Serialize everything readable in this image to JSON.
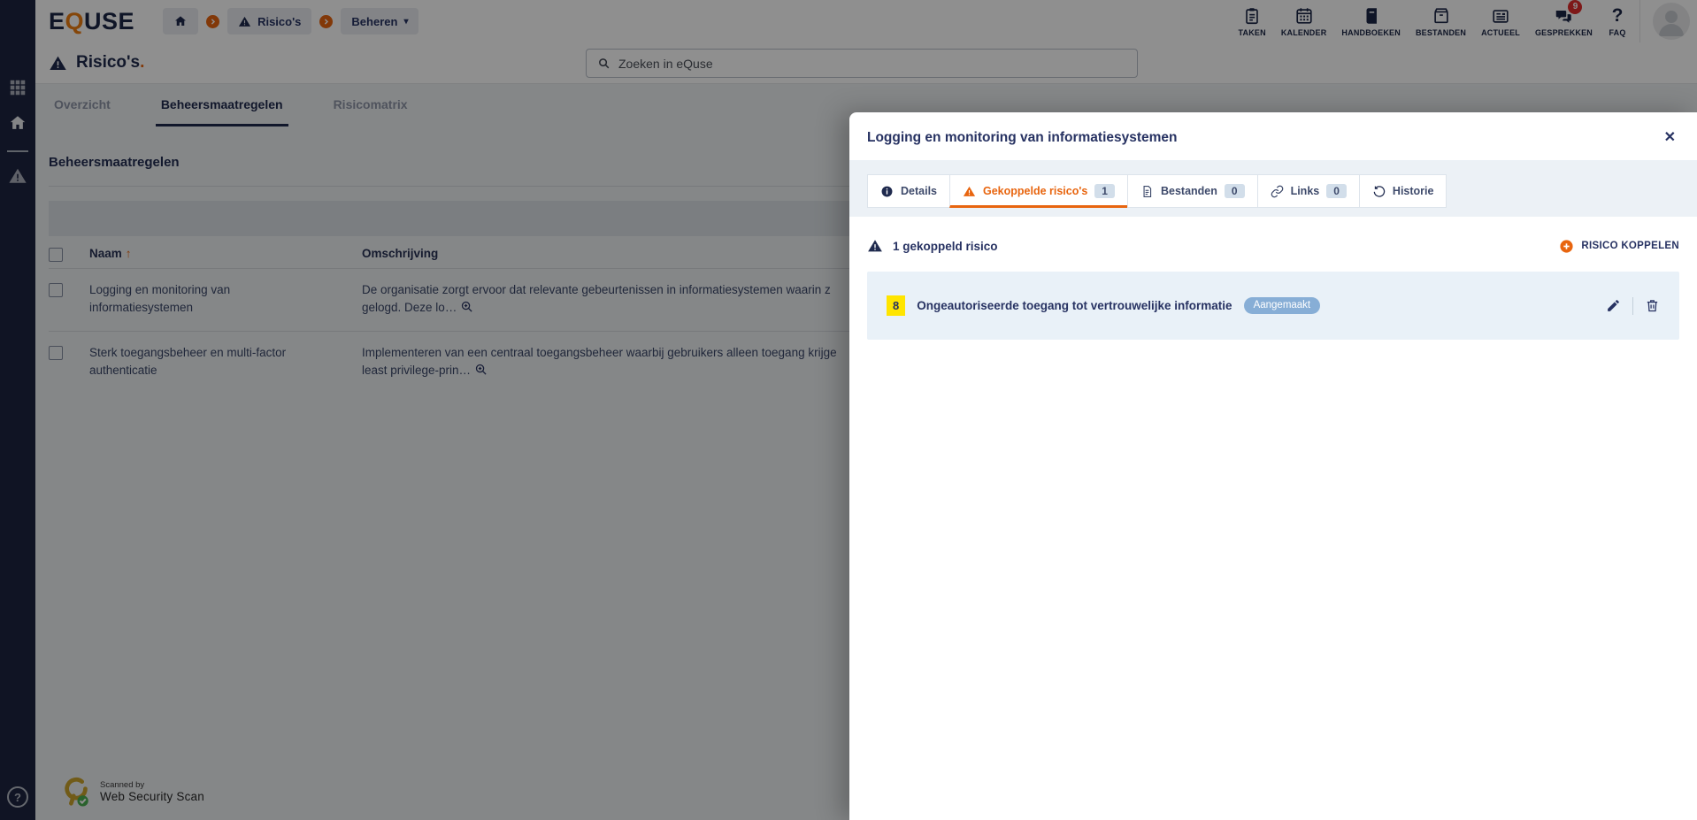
{
  "colors": {
    "accent_orange": "#e8650f",
    "brand_navy": "#1f2a4e",
    "status_blue": "#87aed6",
    "risk_yellow": "#ffe500",
    "badge_red": "#e02b2b"
  },
  "brand": {
    "logo_e": "E",
    "logo_q": "Q",
    "logo_use": "USE"
  },
  "header": {
    "breadcrumb": {
      "risicos_label": "Risico's",
      "beheren_label": "Beheren"
    },
    "nav": [
      {
        "label": "TAKEN",
        "icon": "clipboard-icon"
      },
      {
        "label": "KALENDER",
        "icon": "calendar-icon"
      },
      {
        "label": "HANDBOEKEN",
        "icon": "book-icon"
      },
      {
        "label": "BESTANDEN",
        "icon": "archive-box-icon"
      },
      {
        "label": "ACTUEEL",
        "icon": "newspaper-icon"
      },
      {
        "label": "GESPREKKEN",
        "icon": "chat-icon",
        "badge": "9"
      },
      {
        "label": "FAQ",
        "icon": "question-icon"
      }
    ]
  },
  "page": {
    "title": "Risico's",
    "title_suffix": ".",
    "search": {
      "placeholder": "Zoeken in eQuse"
    },
    "tabs": [
      {
        "label": "Overzicht"
      },
      {
        "label": "Beheersmaatregelen",
        "active": true
      },
      {
        "label": "Risicomatrix"
      }
    ],
    "section_title": "Beheersmaatregelen",
    "table": {
      "columns": {
        "name": "Naam",
        "description": "Omschrijving"
      },
      "rows": [
        {
          "name_line1": "Logging en monitoring van",
          "name_line2": "informatiesystemen",
          "desc_line1": "De organisatie zorgt ervoor dat relevante gebeurtenissen in informatiesystemen waarin z",
          "desc_line2": "gelogd. Deze lo…"
        },
        {
          "name_line1": "Sterk toegangsbeheer en multi-factor",
          "name_line2": "authenticatie",
          "desc_line1": "Implementeren van een centraal toegangsbeheer waarbij gebruikers alleen toegang krijge",
          "desc_line2": "least privilege-prin…"
        }
      ]
    }
  },
  "modal": {
    "title": "Logging en monitoring van informatiesystemen",
    "tabs": [
      {
        "label": "Details",
        "icon": "info-icon"
      },
      {
        "label": "Gekoppelde risico's",
        "icon": "warning-icon",
        "badge": "1",
        "active": true
      },
      {
        "label": "Bestanden",
        "icon": "file-icon",
        "badge": "0"
      },
      {
        "label": "Links",
        "icon": "link-icon",
        "badge": "0"
      },
      {
        "label": "Historie",
        "icon": "history-icon"
      }
    ],
    "linked_count": "1 gekoppeld risico",
    "link_button": "RISICO KOPPELEN",
    "risk": {
      "number": "8",
      "title": "Ongeautoriseerde toegang tot vertrouwelijke informatie",
      "status": "Aangemaakt"
    }
  },
  "footer": {
    "scanned_by": "Scanned by",
    "scanner": "Web Security Scan"
  },
  "icons": {
    "close": "✕",
    "sort_asc": "↑",
    "caret_down": "▾",
    "question": "?"
  }
}
